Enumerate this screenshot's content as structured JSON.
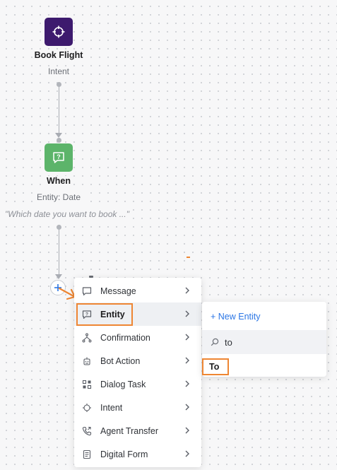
{
  "flow": {
    "nodes": [
      {
        "title": "Book Flight",
        "subtitle": "Intent",
        "icon": "crosshair-icon",
        "color": "#3d1a6e"
      },
      {
        "title": "When",
        "subtitle": "Entity: Date",
        "icon": "question-message-icon",
        "color": "#5cb46a",
        "prompt": "\"Which date you want to book ...\""
      }
    ]
  },
  "menu": {
    "items": [
      {
        "label": "Message",
        "icon": "message-icon"
      },
      {
        "label": "Entity",
        "icon": "entity-icon"
      },
      {
        "label": "Confirmation",
        "icon": "confirmation-icon"
      },
      {
        "label": "Bot Action",
        "icon": "bot-action-icon"
      },
      {
        "label": "Dialog Task",
        "icon": "dialog-task-icon"
      },
      {
        "label": "Intent",
        "icon": "intent-icon"
      },
      {
        "label": "Agent Transfer",
        "icon": "agent-transfer-icon"
      },
      {
        "label": "Digital Form",
        "icon": "digital-form-icon"
      }
    ],
    "active": "Entity"
  },
  "submenu": {
    "new_entity_label": "+ New Entity",
    "search_value": "to",
    "results": [
      "To"
    ]
  },
  "colors": {
    "highlight": "#ee8633",
    "link": "#2b76e5"
  }
}
